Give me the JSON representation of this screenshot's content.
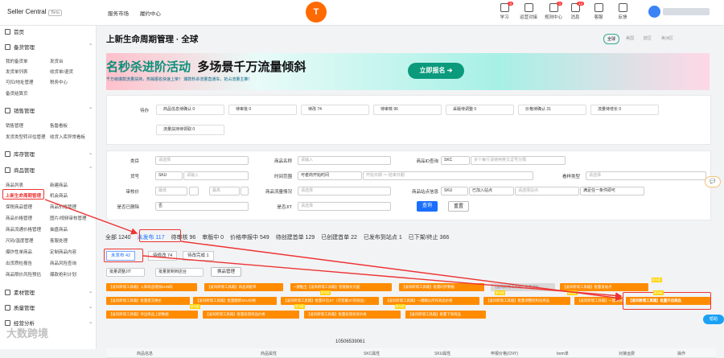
{
  "header": {
    "logo": "Seller Central",
    "beta": "Beta",
    "nav": [
      "服务市场",
      "履约中心"
    ],
    "brand": "T",
    "tools": [
      {
        "label": "学习",
        "badge": "8"
      },
      {
        "label": "运营对接",
        "badge": ""
      },
      {
        "label": "规则中心",
        "badge": "0"
      },
      {
        "label": "消息",
        "badge": "14"
      },
      {
        "label": "客服",
        "badge": ""
      },
      {
        "label": "反馈",
        "badge": ""
      }
    ]
  },
  "sidebar": {
    "home": "首页",
    "s1": {
      "title": "备货管理",
      "items": [
        "我的备货单",
        "发货台",
        "发货单列表",
        "收货单/退货",
        "可扣/地址管理",
        "税务中心",
        "备货结算页"
      ]
    },
    "s2": {
      "title": "销售管理",
      "items": [
        "销售管理",
        "售罄看板",
        "发货类型转评估管理",
        "收货入库异常看板"
      ]
    },
    "s3": {
      "title": "库存管理"
    },
    "s4": {
      "title": "商品管理",
      "items": [
        "商品列表",
        "新建商品",
        "上新生命周期管理",
        "机会商品",
        "保税商品管理",
        "商品价格管理",
        "商品价格管理",
        "图片/视频审核管理",
        "商品流通价格管理",
        "抽盘商品",
        "尺码/温度管理",
        "客服处理",
        "爆炸性单商品",
        "定制商品内容",
        "出货质检报告",
        "商品风险查询",
        "商品限价风险预估",
        "爆款抢利计划"
      ]
    },
    "s5": {
      "title": "素材管理"
    },
    "s6": {
      "title": "质量管理"
    },
    "s7": {
      "title": "经营分析"
    }
  },
  "main": {
    "title": "上新生命周期管理 · 全球",
    "sites": [
      "全球",
      "美国",
      "欧区",
      "美洲区"
    ]
  },
  "banner": {
    "headline_a": "名",
    "headline_b": "秒杀进阶活动",
    "headline_c": "多场景千万流量倾斜",
    "sub": "千万级爆款流量扶持，热销报名快速上架！ 爆款秒杀流量直通车，抢占流量主推！",
    "cta": "立即报名 ➔"
  },
  "stats": {
    "label": "待办",
    "row1": [
      "商品信息待确认 0",
      "待审批 0",
      "待改 74",
      "待审核 96",
      "采版待调整 0",
      "价格待确认 31",
      "流量待增长 0"
    ],
    "row2": "流量扶持待领取 0"
  },
  "filters": {
    "cat": "类目",
    "cat_ph": "请选择",
    "name": "商品名称",
    "name_ph": "请输入",
    "idq": "商品ID查询",
    "idq_sel": "SKC",
    "idq_ph": "多个每行请使用英文逗号分隔",
    "hh": "货号",
    "hh_sel": "SKU",
    "hh_ph": "请输入",
    "tr": "时间范围",
    "tr_sel": "可者商开始时间",
    "tr_ph": "开始日期 ～ 结束日期",
    "lx": "看样类型",
    "lx_ph": "请选择",
    "price": "审核价",
    "pmin": "最低",
    "pmax": "最高",
    "flow": "商品流量情况",
    "flow_ph": "请选择",
    "site": "商品站点信息",
    "site_sel": "SKU",
    "site_v": "已加入站点",
    "site_ph": "请选择站点",
    "site_c": "满足任一条件即可",
    "del": "是否已删除",
    "del_v": "否",
    "jit": "是否JIT",
    "jit_ph": "请选择",
    "query": "查询",
    "reset": "重置"
  },
  "tabs": [
    "全部 1240",
    "未发布 117",
    "待审核 96",
    "审版中 0",
    "价格申报中 549",
    "待创建首单 129",
    "已创建首单 22",
    "已发布到站点 1",
    "已下架/终止 366"
  ],
  "subtabs": [
    "未发布 42",
    "待修改 74",
    "待改完成 1"
  ],
  "controls": {
    "bulk": "批量调整JIT",
    "bulkop": "批量复制到店台",
    "prod": "换品管理"
  },
  "orange_row1": [
    "【凌风跨境工具箱】入库商品增加SUN码",
    "【凌风跨境工具箱】商品调配单",
    "一键推出【凌风跨境工具箱】智能报价页面",
    "【凌风跨境工具箱】批量同步数据",
    "【凌风跨境工具箱】批量调价",
    "【凌风跨境工具箱】批量发站点"
  ],
  "orange_row2": [
    "【凌风跨境工具箱】批量提交换价",
    "【凌风跨境工具箱】批量翻新SKU价格",
    "【凌风跨境工具箱】批量开启JIT（可签署JIT的商品）",
    "【凌风跨境工具箱】一键确认所有商品价格",
    "【凌风跨境工具箱】批量调整结构化商品",
    "【凌风跨境工具箱】一键关闭全部"
  ],
  "orange_row3": [
    "【凌风跨境工具箱】导出商品上新数据",
    "【凌风跨境工具箱】批量处理商品价格",
    "【凌风跨境工具箱】批量处理投诉价格",
    "【凌风跨境工具箱】批量下架商品"
  ],
  "highlighted": "【凌风跨境工具箱】批量开启商品",
  "tags": [
    "新功能",
    "新功能",
    "新功能",
    "新功能",
    "新功能",
    "新功能",
    "新功能",
    "新功能"
  ],
  "table": {
    "headers": [
      "商品信息",
      "商品属性",
      "SKC属性",
      "SKU属性",
      "申报价格(CNY)",
      "bom单",
      "对接运费",
      "操作"
    ],
    "sku_label": "SKU属性表",
    "sku": "10506539061"
  },
  "side": {
    "chat": "💬",
    "help": "帮助"
  },
  "watermark": "大数跨境",
  "colors": {
    "accent": "#1a6fff",
    "orange": "#ff8c00",
    "red": "#e33333",
    "teal": "#0b9a7c"
  }
}
